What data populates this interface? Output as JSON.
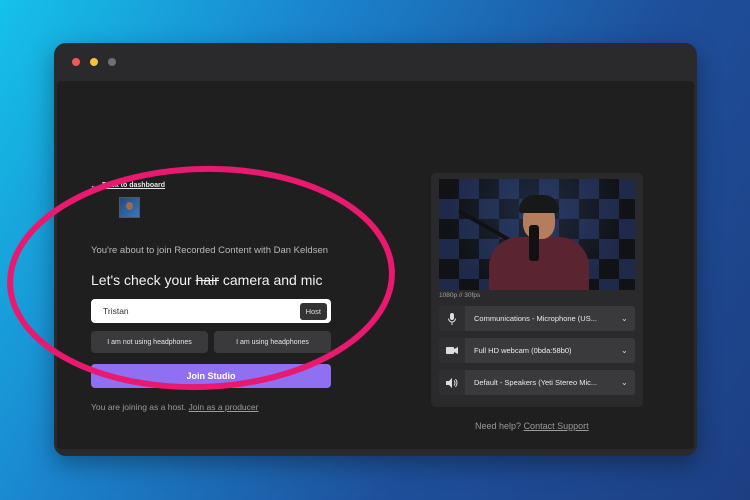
{
  "nav": {
    "back_label": "Back to dashboard"
  },
  "join": {
    "intro": "You're about to join Recorded Content with Dan Keldsen",
    "headline_prefix": "Let's check your ",
    "headline_strike": "hair",
    "headline_suffix": " camera and mic",
    "name_value": "Tristan",
    "role_badge": "Host",
    "headphones_no": "I am not using headphones",
    "headphones_yes": "I am using headphones",
    "join_button": "Join Studio",
    "joining_text": "You are joining as a host.",
    "producer_link": "Join as a producer"
  },
  "preview": {
    "resolution": "1080p // 30fps",
    "devices": [
      {
        "icon": "microphone-icon",
        "label": "Communications - Microphone (US..."
      },
      {
        "icon": "camera-icon",
        "label": "Full HD webcam (0bda:58b0)"
      },
      {
        "icon": "speaker-icon",
        "label": "Default - Speakers (Yeti Stereo Mic..."
      }
    ]
  },
  "help": {
    "text": "Need help?",
    "link": "Contact Support"
  },
  "colors": {
    "accent": "#8f6ff2",
    "highlight": "#e8196e"
  }
}
